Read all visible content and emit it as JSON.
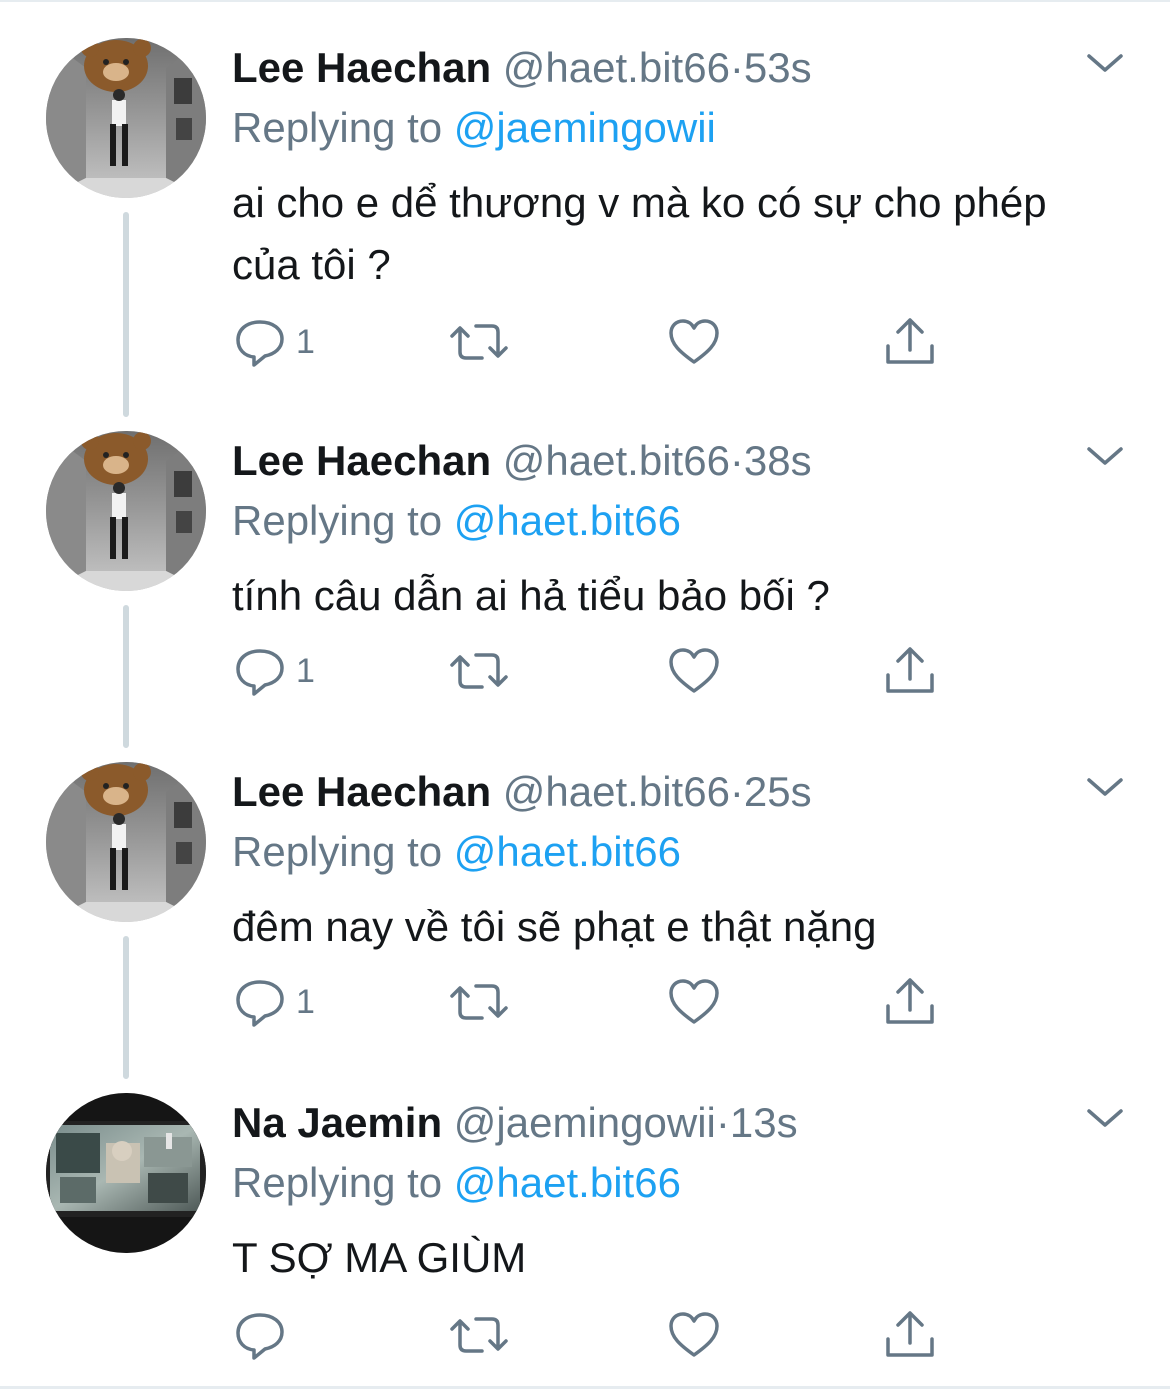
{
  "tweets": [
    {
      "name": "Lee Haechan",
      "handle": "@haet.bit66",
      "separator": "·",
      "time": "53s",
      "replying_prefix": "Replying to ",
      "replying_to": "@jaemingowii",
      "text": "ai cho e dể thương v mà ko có sự cho phép của tôi ?",
      "reply_count": "1"
    },
    {
      "name": "Lee Haechan",
      "handle": "@haet.bit66",
      "separator": "·",
      "time": "38s",
      "replying_prefix": "Replying to ",
      "replying_to": "@haet.bit66",
      "text": "tính câu dẫn ai hả tiểu bảo bối ?",
      "reply_count": "1"
    },
    {
      "name": "Lee Haechan",
      "handle": "@haet.bit66",
      "separator": "·",
      "time": "25s",
      "replying_prefix": "Replying to ",
      "replying_to": "@haet.bit66",
      "text": "đêm nay về tôi sẽ phạt e thật nặng",
      "reply_count": "1"
    },
    {
      "name": "Na Jaemin",
      "handle": "@jaemingowii",
      "separator": "·",
      "time": "13s",
      "replying_prefix": "Replying to ",
      "replying_to": "@haet.bit66",
      "text": "T SỢ MA GIÙM",
      "reply_count": ""
    }
  ],
  "icons": {
    "reply": "reply-icon",
    "retweet": "retweet-icon",
    "like": "heart-icon",
    "share": "share-icon",
    "more": "chevron-down-icon"
  },
  "colors": {
    "text": "#14171a",
    "secondary": "#657786",
    "link": "#1da1f2",
    "thread_line": "#cfd9de",
    "icon": "#657786"
  }
}
